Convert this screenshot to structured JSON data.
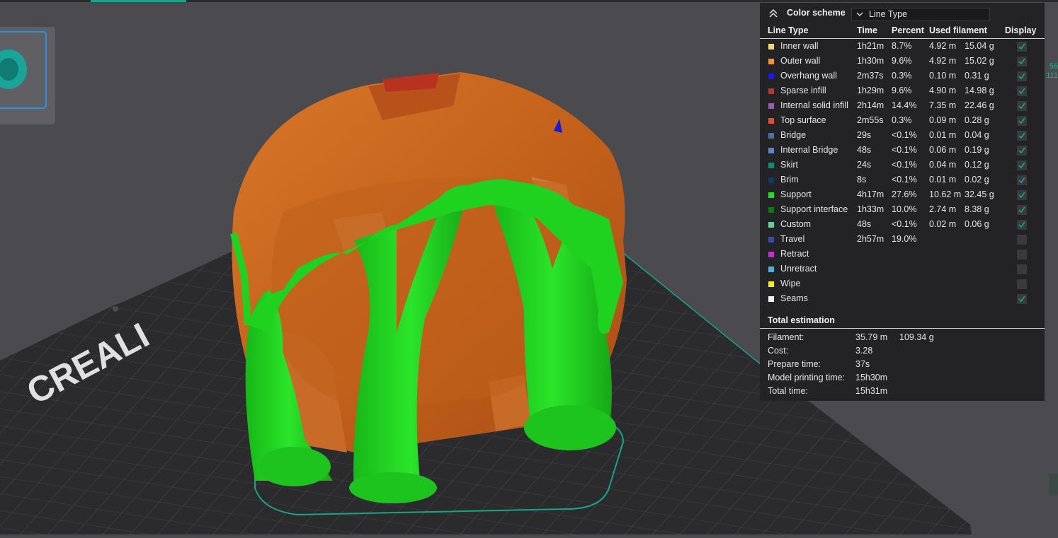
{
  "scene": {
    "bed_logo_text": "CREALI",
    "colors": {
      "support": "#1fd21f",
      "wall": "#c8651e",
      "bed": "#2b2b2e",
      "background": "#4a4a4f",
      "accent": "#17a589"
    },
    "right_edge_numbers": [
      "56",
      "111"
    ]
  },
  "panel": {
    "collapse_icon": "double-chevron-up-icon",
    "color_scheme_label": "Color scheme",
    "color_scheme_value": "Line Type",
    "headers": {
      "line_type": "Line Type",
      "time": "Time",
      "percent": "Percent",
      "used_filament": "Used filament",
      "display": "Display"
    },
    "rows": [
      {
        "name": "Inner wall",
        "time": "1h21m",
        "percent": "8.7%",
        "length": "4.92 m",
        "weight": "15.04 g",
        "color": "#f5d76e",
        "checked": true
      },
      {
        "name": "Outer wall",
        "time": "1h30m",
        "percent": "9.6%",
        "length": "4.92 m",
        "weight": "15.02 g",
        "color": "#f0903a",
        "checked": true
      },
      {
        "name": "Overhang wall",
        "time": "2m37s",
        "percent": "0.3%",
        "length": "0.10 m",
        "weight": "0.31 g",
        "color": "#1a1aee",
        "checked": true
      },
      {
        "name": "Sparse infill",
        "time": "1h29m",
        "percent": "9.6%",
        "length": "4.90 m",
        "weight": "14.98 g",
        "color": "#b03a2e",
        "checked": true
      },
      {
        "name": "Internal solid infill",
        "time": "2h14m",
        "percent": "14.4%",
        "length": "7.35 m",
        "weight": "22.46 g",
        "color": "#9b59b6",
        "checked": true
      },
      {
        "name": "Top surface",
        "time": "2m55s",
        "percent": "0.3%",
        "length": "0.09 m",
        "weight": "0.28 g",
        "color": "#e74c3c",
        "checked": true
      },
      {
        "name": "Bridge",
        "time": "29s",
        "percent": "<0.1%",
        "length": "0.01 m",
        "weight": "0.04 g",
        "color": "#4a6fa5",
        "checked": true
      },
      {
        "name": "Internal Bridge",
        "time": "48s",
        "percent": "<0.1%",
        "length": "0.06 m",
        "weight": "0.19 g",
        "color": "#5b86c6",
        "checked": true
      },
      {
        "name": "Skirt",
        "time": "24s",
        "percent": "<0.1%",
        "length": "0.04 m",
        "weight": "0.12 g",
        "color": "#138a72",
        "checked": true
      },
      {
        "name": "Brim",
        "time": "8s",
        "percent": "<0.1%",
        "length": "0.01 m",
        "weight": "0.02 g",
        "color": "#0e3a6e",
        "checked": true
      },
      {
        "name": "Support",
        "time": "4h17m",
        "percent": "27.6%",
        "length": "10.62 m",
        "weight": "32.45 g",
        "color": "#22dd22",
        "checked": true
      },
      {
        "name": "Support interface",
        "time": "1h33m",
        "percent": "10.0%",
        "length": "2.74 m",
        "weight": "8.38 g",
        "color": "#0f7a0f",
        "checked": true
      },
      {
        "name": "Custom",
        "time": "48s",
        "percent": "<0.1%",
        "length": "0.02 m",
        "weight": "0.06 g",
        "color": "#5ed39a",
        "checked": true
      },
      {
        "name": "Travel",
        "time": "2h57m",
        "percent": "19.0%",
        "length": "",
        "weight": "",
        "color": "#3a48b0",
        "checked": false
      },
      {
        "name": "Retract",
        "time": "",
        "percent": "",
        "length": "",
        "weight": "",
        "color": "#c42ed8",
        "checked": false
      },
      {
        "name": "Unretract",
        "time": "",
        "percent": "",
        "length": "",
        "weight": "",
        "color": "#4eb3d8",
        "checked": false
      },
      {
        "name": "Wipe",
        "time": "",
        "percent": "",
        "length": "",
        "weight": "",
        "color": "#f5f01a",
        "checked": false
      },
      {
        "name": "Seams",
        "time": "",
        "percent": "",
        "length": "",
        "weight": "",
        "color": "#f0f0f0",
        "checked": true
      }
    ],
    "total": {
      "title": "Total estimation",
      "filament_label": "Filament:",
      "filament_length": "35.79 m",
      "filament_weight": "109.34 g",
      "cost_label": "Cost:",
      "cost": "3.28",
      "prepare_label": "Prepare time:",
      "prepare": "37s",
      "model_print_label": "Model printing time:",
      "model_print": "15h30m",
      "total_label": "Total time:",
      "total": "15h31m"
    }
  }
}
